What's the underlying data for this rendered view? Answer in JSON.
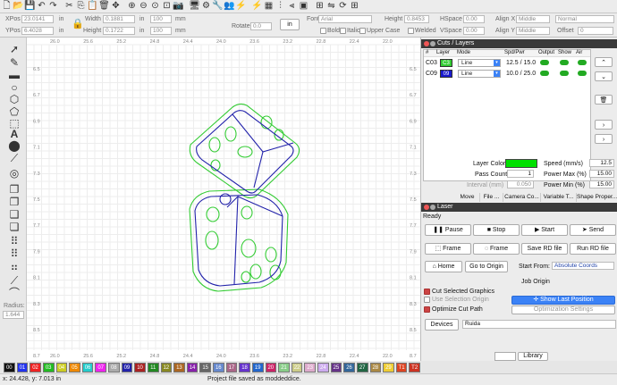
{
  "toolbar": {
    "icons": [
      "new-file-icon",
      "open-file-icon",
      "save-icon",
      "undo-icon",
      "redo-icon",
      "cut-icon",
      "copy-icon",
      "paste-icon",
      "delete-icon",
      "move-icon",
      "zoom-in-icon",
      "zoom-out-icon",
      "zoom-extents-icon",
      "zoom-frame-icon",
      "camera-icon",
      "monitor-icon",
      "settings-icon",
      "tools-icon",
      "users-icon",
      "weld-icon",
      "bolt-icon",
      "array-icon",
      "align-icon",
      "distribute-icon",
      "group-icon",
      "dock-icon",
      "mirror-icon",
      "rotate-icon",
      "grid-icon"
    ]
  },
  "props": {
    "xpos_label": "XPos",
    "xpos_value": "23.0141",
    "ypos_label": "YPos",
    "ypos_value": "6.4028",
    "unit1": "in",
    "unit2": "in",
    "width_label": "Width",
    "width_value": "0.1881",
    "height_label": "Height",
    "height_value": "0.1722",
    "unit3": "in",
    "unit4": "in",
    "pct1": "100",
    "pct2": "100",
    "pct_unit1": "mm",
    "pct_unit2": "mm",
    "rotate_label": "Rotate",
    "rotate_value": "0.0",
    "in_button": "in",
    "font_label": "Font",
    "font_value": "Arial",
    "font_height_label": "Height",
    "font_height_value": "0.8453",
    "hspace_label": "HSpace",
    "hspace_value": "0.00",
    "vspace_label": "VSpace",
    "vspace_value": "0.00",
    "alignx_label": "Align X",
    "alignx_value": "Middle",
    "aligny_label": "Align Y",
    "aligny_value": "Middle",
    "style_value": "Normal",
    "offset_label": "Offset",
    "offset_value": "0",
    "bold": "Bold",
    "italic": "Italic",
    "upper": "Upper Case",
    "welded": "Welded"
  },
  "ruler": {
    "top": [
      "26.0",
      "25.6",
      "25.2",
      "24.8",
      "24.4",
      "24.0",
      "23.6",
      "23.2",
      "22.8",
      "22.4",
      "22.0"
    ],
    "bottom": [
      "26.0",
      "25.6",
      "25.2",
      "24.8",
      "24.4",
      "24.0",
      "23.6",
      "23.2",
      "22.8",
      "22.4",
      "22.0"
    ],
    "left": [
      "6.5",
      "6.7",
      "6.9",
      "7.1",
      "7.3",
      "7.5",
      "7.7",
      "7.9",
      "8.1",
      "8.3",
      "8.5",
      "8.7"
    ],
    "right": [
      "6.5",
      "6.7",
      "6.9",
      "7.1",
      "7.3",
      "7.5",
      "7.7",
      "7.9",
      "8.1",
      "8.3",
      "8.5",
      "8.7"
    ]
  },
  "left_tools": {
    "radius_label": "Radius:",
    "radius_value": "1.644"
  },
  "cuts": {
    "title": "Cuts / Layers",
    "headers": [
      "#",
      "Layer",
      "Mode",
      "Spd/Pwr",
      "Output",
      "Show",
      "Air"
    ],
    "rows": [
      {
        "num": "C03",
        "layer": "C3",
        "color": "#33cc33",
        "mode": "Line",
        "spdpwr": "12.5 / 15.0"
      },
      {
        "num": "C09",
        "layer": "09",
        "color": "#1a1acc",
        "mode": "Line",
        "spdpwr": "10.0 / 25.0"
      }
    ],
    "layer_color_label": "Layer Color",
    "layer_color": "#00e000",
    "speed_label": "Speed (mm/s)",
    "speed_value": "12.5",
    "pass_label": "Pass Count",
    "pass_value": "1",
    "pmax_label": "Power Max (%)",
    "pmax_value": "15.00",
    "interval_label": "Interval (mm)",
    "interval_value": "0.050",
    "pmin_label": "Power Min (%)",
    "pmin_value": "15.00",
    "tabs": [
      "Move",
      "File ...",
      "Camera Co...",
      "Variable T...",
      "Shape Proper..."
    ]
  },
  "laser": {
    "title": "Laser",
    "status": "Ready",
    "pause": "Pause",
    "stop": "Stop",
    "start": "Start",
    "send": "Send",
    "frame1": "Frame",
    "frame2": "Frame",
    "save_rd": "Save RD file",
    "run_rd": "Run RD file",
    "home": "Home",
    "goto_origin": "Go to Origin",
    "start_from_label": "Start From:",
    "start_from_value": "Absolute Coords",
    "job_origin_label": "Job Origin",
    "cut_selected": "Cut Selected Graphics",
    "use_selection": "Use Selection Origin",
    "optimize": "Optimize Cut Path",
    "show_last": "Show Last Position",
    "opt_settings": "Optimization Settings",
    "devices_label": "Devices",
    "device_value": "Ruida",
    "library_tab": "Library"
  },
  "palette": [
    {
      "n": "00",
      "c": "#111111"
    },
    {
      "n": "01",
      "c": "#2233ee"
    },
    {
      "n": "02",
      "c": "#ee2222"
    },
    {
      "n": "03",
      "c": "#22bb22"
    },
    {
      "n": "04",
      "c": "#cccc22"
    },
    {
      "n": "05",
      "c": "#ee8800"
    },
    {
      "n": "06",
      "c": "#22cccc"
    },
    {
      "n": "07",
      "c": "#ee22ee"
    },
    {
      "n": "08",
      "c": "#aaaaaa"
    },
    {
      "n": "09",
      "c": "#2222aa"
    },
    {
      "n": "10",
      "c": "#aa2222"
    },
    {
      "n": "11",
      "c": "#228822"
    },
    {
      "n": "12",
      "c": "#888822"
    },
    {
      "n": "13",
      "c": "#aa6622"
    },
    {
      "n": "14",
      "c": "#8822aa"
    },
    {
      "n": "15",
      "c": "#666666"
    },
    {
      "n": "16",
      "c": "#6688cc"
    },
    {
      "n": "17",
      "c": "#aa6688"
    },
    {
      "n": "18",
      "c": "#6633cc"
    },
    {
      "n": "19",
      "c": "#2266cc"
    },
    {
      "n": "20",
      "c": "#cc2266"
    },
    {
      "n": "21",
      "c": "#88cc88"
    },
    {
      "n": "22",
      "c": "#cccc88"
    },
    {
      "n": "23",
      "c": "#ddaacc"
    },
    {
      "n": "24",
      "c": "#ccaaee"
    },
    {
      "n": "25",
      "c": "#663388"
    },
    {
      "n": "26",
      "c": "#336699"
    },
    {
      "n": "27",
      "c": "#226644"
    },
    {
      "n": "28",
      "c": "#aa8844"
    },
    {
      "n": "29",
      "c": "#eecc33"
    },
    {
      "n": "T1",
      "c": "#dd4422"
    },
    {
      "n": "T2",
      "c": "#cc3322"
    }
  ],
  "status": {
    "coords": "x: 24.428, y: 7.013 in",
    "message": "Project file saved as moddeddice."
  }
}
